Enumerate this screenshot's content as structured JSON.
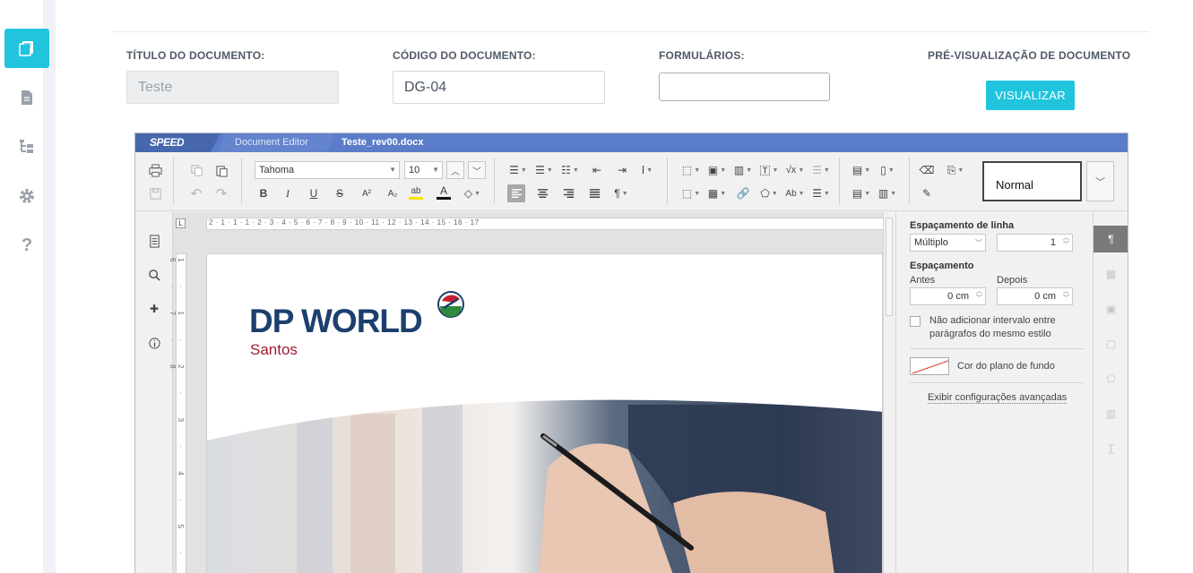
{
  "sidebar": {
    "items": [
      {
        "icon": "documents-icon",
        "active": true
      },
      {
        "icon": "file-icon",
        "active": false
      },
      {
        "icon": "tree-icon",
        "active": false
      },
      {
        "icon": "gear-icon",
        "active": false
      },
      {
        "icon": "help-icon",
        "active": false
      }
    ]
  },
  "form": {
    "title_label": "TÍTULO DO DOCUMENTO:",
    "title_value": "Teste",
    "code_label": "CÓDIGO DO DOCUMENTO:",
    "code_value": "DG-04",
    "forms_label": "FORMULÁRIOS:",
    "forms_value": "",
    "preview_label": "PRÉ-VISUALIZAÇÃO DE DOCUMENTO",
    "preview_button": "VISUALIZAR"
  },
  "editor": {
    "logo": "SPEED",
    "tab_editor": "Document Editor",
    "tab_file": "Teste_rev00.docx",
    "font_name": "Tahoma",
    "font_size": "10",
    "style_name": "Normal",
    "ruler_h": "2 · 1 · 1 · 1 · 2 · 3 · 4 · 5 · 6 · 7 · 8 · 9 · 10 · 11 · 12 · 13 · 14 · 15 · 16 · 17",
    "ruler_v": "1 · 1 · 2 · 3 · 4 · 5 · 6 · 7 · 8"
  },
  "document": {
    "brand_main": "DP WORLD",
    "brand_sub": "Santos"
  },
  "panel": {
    "line_spacing_title": "Espaçamento de linha",
    "line_spacing_mode": "Múltiplo",
    "line_spacing_value": "1",
    "spacing_title": "Espaçamento",
    "before_label": "Antes",
    "before_value": "0 cm",
    "after_label": "Depois",
    "after_value": "0 cm",
    "no_interval_label": "Não adicionar intervalo entre parágrafos do mesmo estilo",
    "bg_color_label": "Cor do plano de fundo",
    "advanced_link": "Exibir configurações avançadas"
  },
  "colors": {
    "accent": "#21c4dd",
    "titlebar": "#5b7dc9",
    "brand_blue": "#1c3f6e",
    "brand_red": "#9e1b32"
  }
}
